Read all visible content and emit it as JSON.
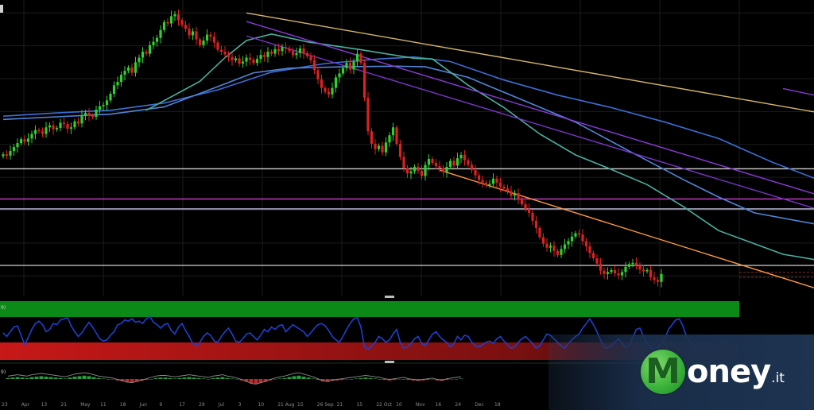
{
  "chart_data": [
    {
      "type": "candlestick",
      "pane": "price",
      "grid": true,
      "x_tick_labels": [
        "23",
        "Apr",
        "13",
        "21",
        "May",
        "11",
        "18",
        "Jun",
        "9",
        "17",
        "29",
        "Jul",
        "3",
        "10",
        "21 Aug",
        "15",
        "26 Sep",
        "21",
        "15",
        "22 Oct",
        "10",
        "Nov",
        "16",
        "24",
        "Dec",
        "18"
      ],
      "closes": [
        18.5,
        18.3,
        19.0,
        19.6,
        20.2,
        20.8,
        20.4,
        20.9,
        21.6,
        22.2,
        22.0,
        21.6,
        22.6,
        22.9,
        22.3,
        22.5,
        23.3,
        23.1,
        22.4,
        22.6,
        23.5,
        23.2,
        24.4,
        24.8,
        24.4,
        24.2,
        25.3,
        25.8,
        26.0,
        26.7,
        27.7,
        29.0,
        29.5,
        30.6,
        31.2,
        31.7,
        30.9,
        32.5,
        33.2,
        34.1,
        33.8,
        35.1,
        35.6,
        36.2,
        37.4,
        38.6,
        38.4,
        39.5,
        39.8,
        38.9,
        38.2,
        37.6,
        36.6,
        37.2,
        36.0,
        35.1,
        35.8,
        36.7,
        36.4,
        35.5,
        34.4,
        34.1,
        33.7,
        33.3,
        32.8,
        33.1,
        32.3,
        32.6,
        33.2,
        32.9,
        32.4,
        33.0,
        33.6,
        33.3,
        34.1,
        33.8,
        34.5,
        34.2,
        34.8,
        34.6,
        34.2,
        33.6,
        33.9,
        34.6,
        33.9,
        33.4,
        32.8,
        31.3,
        29.9,
        28.6,
        28.0,
        27.6,
        28.6,
        30.2,
        30.8,
        31.6,
        32.4,
        31.4,
        32.6,
        33.8,
        32.4,
        27.1,
        22.0,
        20.1,
        19.3,
        19.8,
        18.8,
        20.3,
        21.4,
        22.6,
        20.1,
        18.1,
        16.4,
        15.6,
        15.9,
        16.6,
        16.0,
        15.2,
        16.9,
        17.8,
        17.2,
        16.7,
        16.4,
        15.8,
        16.6,
        17.5,
        16.8,
        17.9,
        18.4,
        17.6,
        16.9,
        16.1,
        15.3,
        14.6,
        14.2,
        13.8,
        14.0,
        14.8,
        14.2,
        13.6,
        13.3,
        12.9,
        12.2,
        12.6,
        11.8,
        10.9,
        10.2,
        9.6,
        8.4,
        7.3,
        5.9,
        4.9,
        4.3,
        4.6,
        3.8,
        3.2,
        4.1,
        4.8,
        5.3,
        6.0,
        6.5,
        6.3,
        5.3,
        4.5,
        3.5,
        2.7,
        1.9,
        0.8,
        0.3,
        0.6,
        0.9,
        0.4,
        0.1,
        0.6,
        1.4,
        1.8,
        2.0,
        1.6,
        1.0,
        0.7,
        0.9,
        -0.2,
        -0.6,
        -0.9,
        0.3
      ],
      "horizontal_levels": [
        {
          "price": 16.3,
          "color": "#cfcfcf"
        },
        {
          "price": 11.7,
          "color": "#d03cd0"
        },
        {
          "price": 10.2,
          "color": "#c8c8e6"
        },
        {
          "price": 1.6,
          "color": "#bdbdbd"
        },
        {
          "price": 0.55,
          "color": "#b83030"
        },
        {
          "price": -0.2,
          "color": "#b83030"
        }
      ],
      "trendlines": [
        {
          "from": [
            68,
            40.0
          ],
          "to": [
            260,
            21.8
          ],
          "color": "#d6b56c"
        },
        {
          "from": [
            68,
            38.7
          ],
          "to": [
            260,
            7.0
          ],
          "color": "#8a3ad8"
        },
        {
          "from": [
            68,
            36.5
          ],
          "to": [
            260,
            4.8
          ],
          "color": "#7a35c8"
        },
        {
          "from": [
            122,
            16.1
          ],
          "to": [
            229,
            -2.2
          ],
          "color": "#ff9a3c"
        },
        {
          "from": [
            218,
            28.5
          ],
          "to": [
            232,
            26.9
          ],
          "color": "#8a3ad8"
        }
      ],
      "moving_averages": [
        {
          "color": "#3b6fd6",
          "values": [
            [
              0,
              24.3
            ],
            [
              15,
              24.8
            ],
            [
              30,
              25.2
            ],
            [
              45,
              26.3
            ],
            [
              60,
              28.3
            ],
            [
              75,
              31.0
            ],
            [
              90,
              32.3
            ],
            [
              105,
              33.0
            ],
            [
              115,
              33.3
            ],
            [
              125,
              32.6
            ],
            [
              140,
              29.8
            ],
            [
              155,
              27.5
            ],
            [
              170,
              25.6
            ],
            [
              185,
              23.4
            ],
            [
              200,
              20.9
            ],
            [
              215,
              17.3
            ],
            [
              229,
              14.4
            ]
          ]
        },
        {
          "color": "#4f86d8",
          "values": [
            [
              0,
              23.8
            ],
            [
              15,
              24.2
            ],
            [
              30,
              24.6
            ],
            [
              45,
              25.7
            ],
            [
              60,
              28.8
            ],
            [
              70,
              30.9
            ],
            [
              80,
              31.6
            ],
            [
              95,
              31.8
            ],
            [
              110,
              31.9
            ],
            [
              118,
              31.8
            ],
            [
              130,
              30.2
            ],
            [
              145,
              26.8
            ],
            [
              160,
              23.4
            ],
            [
              175,
              19.0
            ],
            [
              190,
              14.7
            ],
            [
              200,
              12.0
            ],
            [
              210,
              9.6
            ],
            [
              229,
              7.7
            ]
          ]
        },
        {
          "color": "#4ab0a0",
          "values": [
            [
              40,
              25.2
            ],
            [
              55,
              29.6
            ],
            [
              62,
              33.2
            ],
            [
              68,
              35.8
            ],
            [
              75,
              36.8
            ],
            [
              85,
              35.6
            ],
            [
              100,
              34.4
            ],
            [
              115,
              33.1
            ],
            [
              120,
              33.0
            ],
            [
              130,
              29.0
            ],
            [
              140,
              25.6
            ],
            [
              150,
              21.6
            ],
            [
              160,
              18.4
            ],
            [
              170,
              16.2
            ],
            [
              180,
              13.9
            ],
            [
              190,
              10.6
            ],
            [
              200,
              6.9
            ],
            [
              210,
              4.9
            ],
            [
              218,
              3.3
            ],
            [
              229,
              2.3
            ]
          ]
        }
      ]
    },
    {
      "type": "line",
      "pane": "oscillator",
      "badge": "9)",
      "band_upper_color": "#0c8a17",
      "band_lower_color": "#a01414",
      "color": "#1f3fd0",
      "values": [
        46,
        40,
        48,
        56,
        58,
        42,
        26,
        38,
        52,
        62,
        66,
        60,
        48,
        52,
        62,
        60,
        68,
        70,
        72,
        58,
        48,
        40,
        46,
        56,
        64,
        56,
        46,
        36,
        32,
        34,
        42,
        48,
        60,
        62,
        68,
        66,
        70,
        64,
        66,
        62,
        70,
        74,
        64,
        60,
        54,
        60,
        62,
        50,
        44,
        56,
        62,
        50,
        40,
        28,
        24,
        30,
        40,
        46,
        42,
        32,
        30,
        40,
        48,
        54,
        44,
        32,
        30,
        36,
        44,
        46,
        40,
        34,
        42,
        52,
        48,
        56,
        52,
        58,
        60,
        48,
        54,
        60,
        56,
        52,
        48,
        40,
        46,
        54,
        60,
        62,
        58,
        50,
        40,
        34,
        30,
        40,
        52,
        62,
        70,
        72,
        56,
        22,
        18,
        24,
        30,
        40,
        36,
        30,
        34,
        44,
        52,
        30,
        20,
        22,
        28,
        36,
        40,
        28,
        24,
        34,
        44,
        48,
        40,
        34,
        30,
        22,
        28,
        40,
        34,
        42,
        40,
        30,
        24,
        22,
        26,
        30,
        32,
        28,
        36,
        40,
        32,
        26,
        20,
        22,
        30,
        36,
        40,
        34,
        28,
        20,
        24,
        34,
        44,
        42,
        36,
        30,
        24,
        20,
        28,
        34,
        40,
        44,
        54,
        62,
        70,
        60,
        48,
        34,
        22,
        20,
        24,
        30,
        36,
        28,
        22,
        24,
        38,
        52,
        54,
        40,
        28,
        20,
        18,
        22,
        28,
        36,
        52,
        60,
        68,
        70,
        58,
        40,
        30,
        24,
        20,
        26,
        30,
        24,
        18,
        20,
        26,
        28,
        36
      ],
      "ylim": [
        0,
        100
      ]
    },
    {
      "type": "line",
      "pane": "histogram",
      "badge": "9)",
      "colors": {
        "positive": "#2a9a3a",
        "negative": "#b82c2c",
        "line": "#8a8a8a"
      },
      "values": [
        0.2,
        0.3,
        0.4,
        0.3,
        0.2,
        0.4,
        0.5,
        0.6,
        0.5,
        0.4,
        0.3,
        0.2,
        0.1,
        0.3,
        0.5,
        0.6,
        0.7,
        0.6,
        0.4,
        0.2,
        0.1,
        0.0,
        -0.1,
        -0.3,
        -0.5,
        -0.7,
        -0.8,
        -0.6,
        -0.4,
        -0.2,
        0.0,
        0.2,
        0.3,
        0.3,
        0.2,
        0.1,
        0.2,
        0.3,
        0.4,
        0.3,
        0.2,
        0.1,
        0.0,
        0.2,
        0.3,
        0.4,
        0.2,
        0.1,
        -0.1,
        -0.3,
        -0.6,
        -0.9,
        -1.0,
        -0.8,
        -0.6,
        -0.3,
        -0.1,
        0.1,
        0.2,
        0.4,
        0.6,
        0.7,
        0.5,
        0.3,
        0.1,
        -0.2,
        -0.5,
        -0.6,
        -0.4,
        -0.3,
        -0.2,
        -0.1,
        0.0,
        0.1,
        0.2,
        0.3,
        0.2,
        0.1,
        0.0,
        -0.2,
        -0.3,
        -0.2,
        -0.1,
        0.0,
        -0.2,
        -0.3,
        -0.4,
        -0.3,
        -0.2,
        -0.1,
        -0.3,
        -0.4,
        -0.2,
        -0.1,
        0.0,
        0.1
      ]
    }
  ],
  "logo": {
    "letter": "M",
    "word": "oney",
    "tld": ".it",
    "colors": {
      "green": "#3bb33b",
      "band": "#1d3350"
    }
  }
}
